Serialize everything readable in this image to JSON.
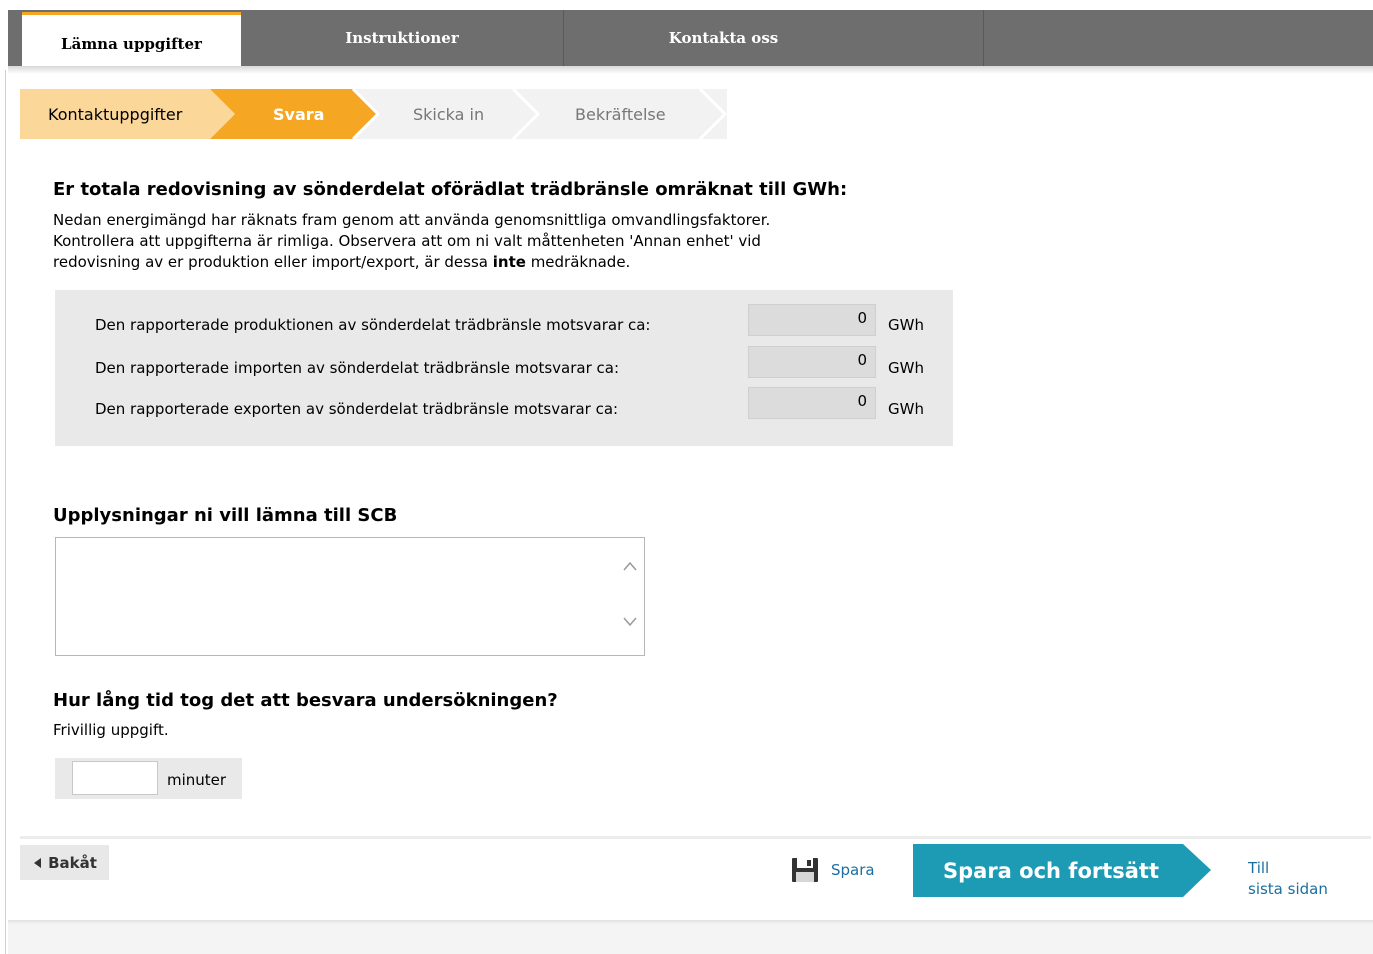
{
  "nav": {
    "tabs": [
      {
        "label": "Lämna uppgifter"
      },
      {
        "label": "Instruktioner"
      },
      {
        "label": "Kontakta oss"
      }
    ]
  },
  "steps": [
    {
      "label": "Kontaktuppgifter"
    },
    {
      "label": "Svara"
    },
    {
      "label": "Skicka in"
    },
    {
      "label": "Bekräftelse"
    }
  ],
  "energy": {
    "heading": "Er totala redovisning av sönderdelat oförädlat trädbränsle omräknat till GWh:",
    "intro_1": "Nedan energimängd har räknats fram genom att använda genomsnittliga omvandlingsfaktorer.",
    "intro_2": "Kontrollera att uppgifterna är rimliga. Observera att om ni valt måttenheten 'Annan enhet' vid",
    "intro_3a": "redovisning av er produktion eller import/export, är dessa ",
    "intro_3b": "inte",
    "intro_3c": " medräknade.",
    "rows": [
      {
        "label": "Den rapporterade produktionen av sönderdelat trädbränsle motsvarar ca:",
        "value": "0",
        "unit": "GWh"
      },
      {
        "label": "Den rapporterade importen av sönderdelat trädbränsle motsvarar ca:",
        "value": "0",
        "unit": "GWh"
      },
      {
        "label": "Den rapporterade exporten av sönderdelat trädbränsle motsvarar ca:",
        "value": "0",
        "unit": "GWh"
      }
    ]
  },
  "comments": {
    "heading": "Upplysningar ni vill lämna till SCB",
    "value": ""
  },
  "time": {
    "heading": "Hur lång tid tog det att besvara undersökningen?",
    "note": "Frivillig uppgift.",
    "value": "",
    "unit": "minuter"
  },
  "footer": {
    "back": "Bakåt",
    "save": "Spara",
    "save_continue": "Spara och fortsätt",
    "last_page_1": "Till",
    "last_page_2": "sista sidan"
  },
  "colors": {
    "nav_bg": "#6e6e6e",
    "accent_orange": "#f5a623",
    "step_done": "#fbd79a",
    "cta_teal": "#1e9bb4"
  }
}
